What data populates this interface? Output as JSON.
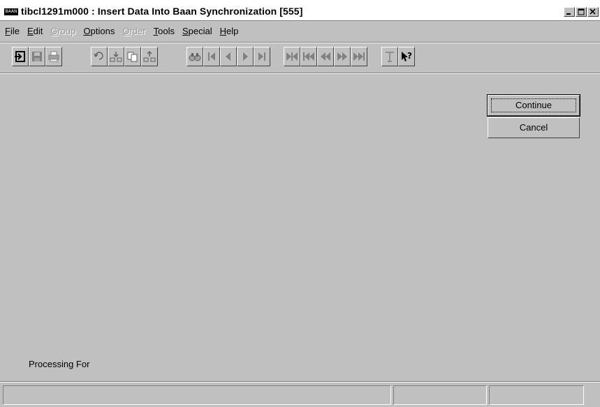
{
  "window": {
    "title": "tibcl1291m000 : Insert Data Into Baan Synchronization [555]",
    "app_icon_label": "BAAN"
  },
  "menu": [
    {
      "label": "File",
      "mnemonic": "F",
      "rest": "ile",
      "enabled": true
    },
    {
      "label": "Edit",
      "mnemonic": "E",
      "rest": "dit",
      "enabled": true
    },
    {
      "label": "Group",
      "mnemonic": "G",
      "rest": "roup",
      "enabled": false
    },
    {
      "label": "Options",
      "mnemonic": "O",
      "rest": "ptions",
      "enabled": true
    },
    {
      "label": "Order",
      "mnemonic": "O",
      "rest": "rder",
      "enabled": false
    },
    {
      "label": "Tools",
      "mnemonic": "T",
      "rest": "ools",
      "enabled": true
    },
    {
      "label": "Special",
      "mnemonic": "S",
      "rest": "pecial",
      "enabled": true
    },
    {
      "label": "Help",
      "mnemonic": "H",
      "rest": "elp",
      "enabled": true
    }
  ],
  "toolbar": [
    {
      "icon": "exit-icon",
      "enabled": true
    },
    {
      "icon": "save-icon",
      "enabled": false
    },
    {
      "icon": "print-icon",
      "enabled": false
    },
    {
      "icon": "undo-icon",
      "enabled": false
    },
    {
      "icon": "insert-record-icon",
      "enabled": false
    },
    {
      "icon": "duplicate-record-icon",
      "enabled": false
    },
    {
      "icon": "delete-record-icon",
      "enabled": false
    },
    {
      "icon": "find-icon",
      "enabled": false
    },
    {
      "icon": "first-record-icon",
      "enabled": false
    },
    {
      "icon": "previous-record-icon",
      "enabled": false
    },
    {
      "icon": "next-record-icon",
      "enabled": false
    },
    {
      "icon": "last-record-icon",
      "enabled": false
    },
    {
      "icon": "first-set-icon",
      "enabled": false
    },
    {
      "icon": "previous-set-icon",
      "enabled": false
    },
    {
      "icon": "previous-page-icon",
      "enabled": false
    },
    {
      "icon": "next-page-icon",
      "enabled": false
    },
    {
      "icon": "last-set-icon",
      "enabled": false
    },
    {
      "icon": "text-icon",
      "enabled": false
    },
    {
      "icon": "context-help-icon",
      "enabled": true
    }
  ],
  "buttons": {
    "continue_label": "Continue",
    "cancel_label": "Cancel"
  },
  "form": {
    "processing_label": "Processing For"
  },
  "status": {
    "pane1": "",
    "pane2": "",
    "pane3": ""
  }
}
